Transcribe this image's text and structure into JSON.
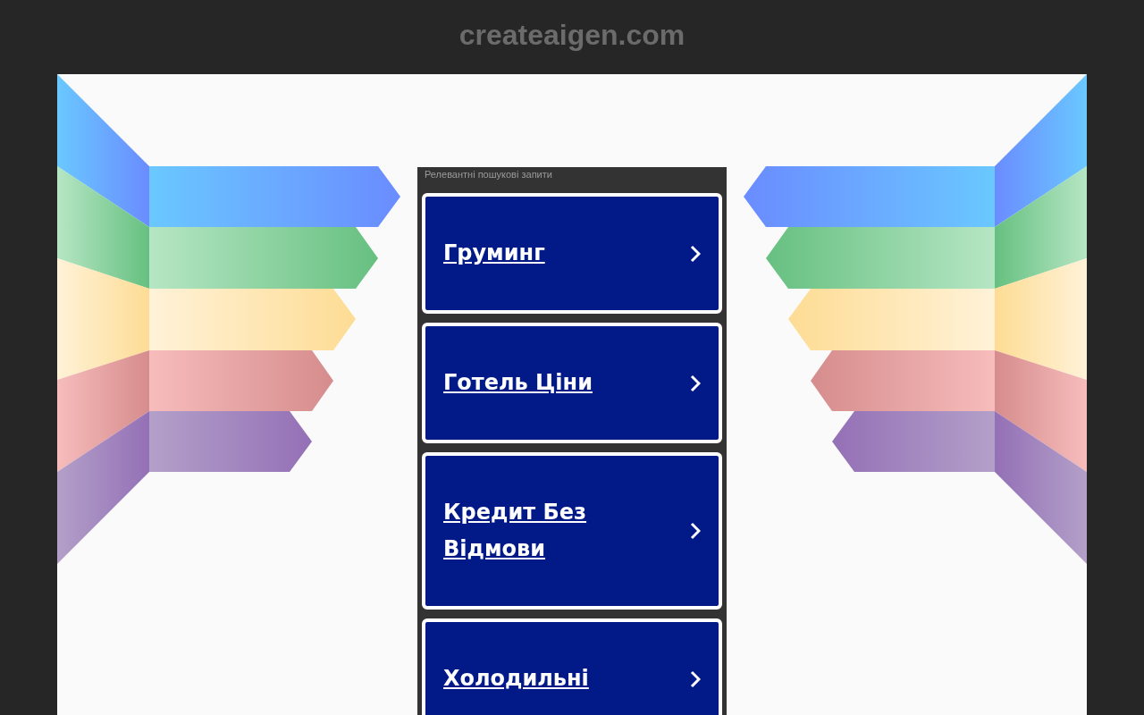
{
  "header": {
    "domain": "createaigen.com"
  },
  "related": {
    "label": "Релевантні пошукові запити",
    "links": [
      {
        "text": "Груминг"
      },
      {
        "text": "Готель Ціни"
      },
      {
        "text": "Кредит Без Відмови"
      },
      {
        "text": "Холодильні"
      }
    ]
  }
}
